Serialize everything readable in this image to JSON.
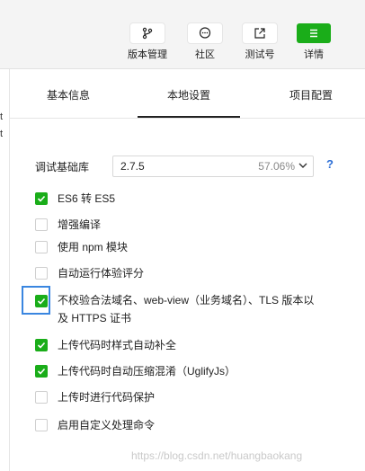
{
  "toolbar": {
    "buttons": [
      {
        "label": "版本管理",
        "icon": "branch-icon"
      },
      {
        "label": "社区",
        "icon": "chat-bubble-icon"
      },
      {
        "label": "测试号",
        "icon": "external-link-icon"
      },
      {
        "label": "详情",
        "icon": "menu-icon",
        "accent": "#1aad19"
      }
    ]
  },
  "left_strip": {
    "chars": [
      "t",
      "t"
    ]
  },
  "tabs": [
    {
      "label": "基本信息",
      "active": false
    },
    {
      "label": "本地设置",
      "active": true
    },
    {
      "label": "项目配置",
      "active": false
    }
  ],
  "library": {
    "label": "调试基础库",
    "version": "2.7.5",
    "percent": "57.06%",
    "help": "?"
  },
  "options": [
    {
      "label": "ES6 转 ES5",
      "checked": true
    },
    {
      "label": "增强编译",
      "checked": false
    },
    {
      "label": "使用 npm 模块",
      "checked": false
    },
    {
      "label": "自动运行体验评分",
      "checked": false
    },
    {
      "label": "不校验合法域名、web-view（业务域名）、TLS 版本以及 HTTPS 证书",
      "checked": true
    },
    {
      "label": "上传代码时样式自动补全",
      "checked": true
    },
    {
      "label": "上传代码时自动压缩混淆（UglifyJs）",
      "checked": true
    },
    {
      "label": "上传时进行代码保护",
      "checked": false
    },
    {
      "label": "启用自定义处理命令",
      "checked": false
    }
  ],
  "colors": {
    "accent": "#1aad19",
    "highlight": "#3a86e0",
    "help": "#2d6fd6"
  },
  "watermark": "https://blog.csdn.net/huangbaokang"
}
